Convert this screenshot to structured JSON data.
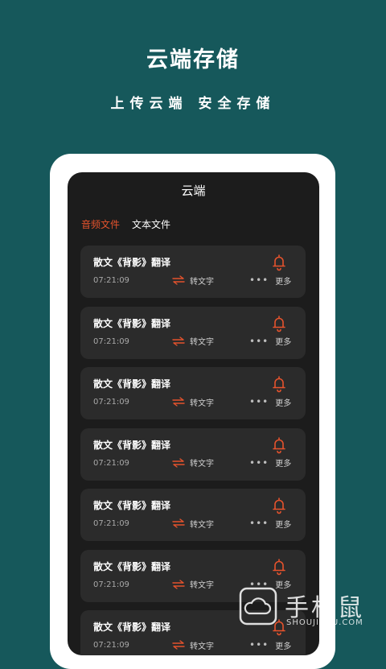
{
  "hero": {
    "title": "云端存储",
    "subtitle": "上传云端 安全存储"
  },
  "screen": {
    "title": "云端",
    "tabs": [
      {
        "label": "音频文件",
        "active": true
      },
      {
        "label": "文本文件",
        "active": false
      }
    ],
    "files": [
      {
        "title": "散文《背影》翻译",
        "time": "07:21:09",
        "convert_label": "转文字",
        "more_label": "更多"
      },
      {
        "title": "散文《背影》翻译",
        "time": "07:21:09",
        "convert_label": "转文字",
        "more_label": "更多"
      },
      {
        "title": "散文《背影》翻译",
        "time": "07:21:09",
        "convert_label": "转文字",
        "more_label": "更多"
      },
      {
        "title": "散文《背影》翻译",
        "time": "07:21:09",
        "convert_label": "转文字",
        "more_label": "更多"
      },
      {
        "title": "散文《背影》翻译",
        "time": "07:21:09",
        "convert_label": "转文字",
        "more_label": "更多"
      },
      {
        "title": "散文《背影》翻译",
        "time": "07:21:09",
        "convert_label": "转文字",
        "more_label": "更多"
      },
      {
        "title": "散文《背影》翻译",
        "time": "07:21:09",
        "convert_label": "转文字",
        "more_label": "更多"
      }
    ]
  },
  "icons": {
    "bell": "bell-icon",
    "convert": "swap-arrows-icon",
    "more": "more-dots-icon"
  },
  "colors": {
    "background": "#16585b",
    "accent": "#e5532d",
    "card": "#2b2b2b",
    "screen": "#1c1c1c"
  },
  "watermark": {
    "text": "手机鼠",
    "url": "SHOUJISHU.COM"
  }
}
